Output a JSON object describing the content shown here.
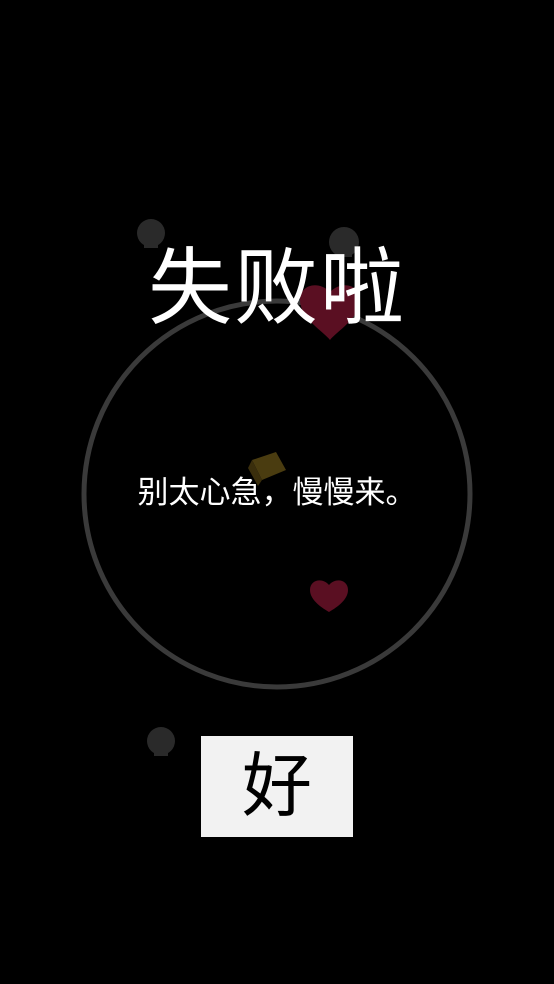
{
  "dialog": {
    "title": "失败啦",
    "message": "别太心急，慢慢来。",
    "ok_label": "好"
  },
  "colors": {
    "background": "#000000",
    "ring": "#3a3a3a",
    "text": "#ffffff",
    "button_bg": "#f2f2f2",
    "heart": "#5a0f22",
    "block": "#4a3c10",
    "orb": "#2a2a2a"
  },
  "icons": {
    "heart": "heart-icon",
    "block": "cube-icon",
    "orb": "orb-icon"
  }
}
